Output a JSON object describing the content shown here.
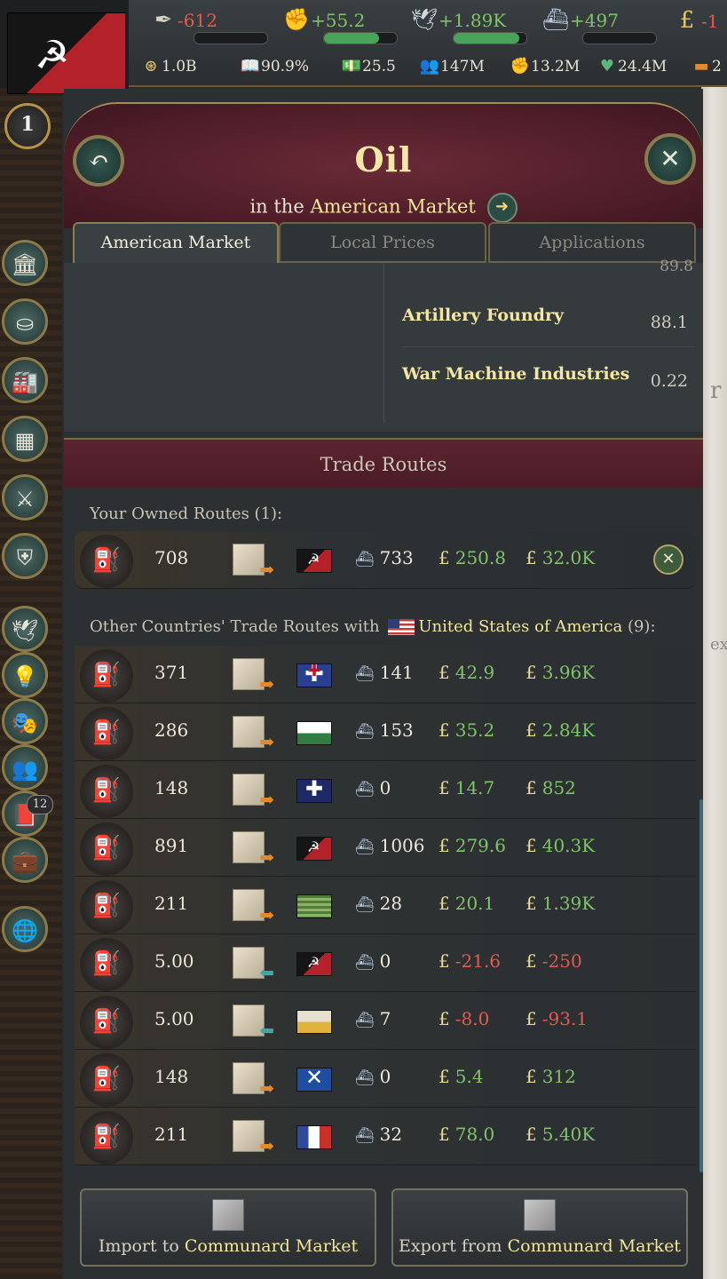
{
  "topbar": {
    "stats": [
      {
        "icon": "quill-icon",
        "value": "-612",
        "tone": "neg",
        "bar": 0.0
      },
      {
        "icon": "fist-icon",
        "value": "+55.2",
        "tone": "pos",
        "bar": 0.75
      },
      {
        "icon": "dove-icon",
        "value": "+1.89K",
        "tone": "pos",
        "bar": 0.9
      },
      {
        "icon": "ship-icon",
        "value": "+497",
        "tone": "pos",
        "bar": 0.0
      },
      {
        "icon": "pound-icon",
        "value": "-1",
        "tone": "neg"
      }
    ],
    "stats2": [
      {
        "icon": "coin-icon",
        "value": "1.0B"
      },
      {
        "icon": "book-icon",
        "value": "90.9%"
      },
      {
        "icon": "money-icon",
        "value": "25.5"
      },
      {
        "icon": "people-icon",
        "value": "147M"
      },
      {
        "icon": "raised-fist-icon",
        "value": "13.2M"
      },
      {
        "icon": "heart-icon",
        "value": "24.4M"
      },
      {
        "icon": "bar-icon",
        "value": "2"
      }
    ],
    "rank": "1"
  },
  "panel": {
    "title": "Oil",
    "subtitle_prefix": "in the",
    "subtitle_market": "American Market",
    "tabs": [
      "American Market",
      "Local Prices",
      "Applications"
    ],
    "buildings_partial_value": "89.8",
    "buildings": [
      {
        "name": "Artillery Foundry",
        "value": "88.1"
      },
      {
        "name": "War Machine Industries",
        "value": "0.22"
      }
    ],
    "trade_routes_title": "Trade Routes",
    "owned_label": "Your Owned Routes (1):",
    "owned_routes": [
      {
        "level": "708",
        "dir": "export",
        "flag": "commune",
        "ships": "733",
        "m1": "250.8",
        "m2": "32.0K",
        "tone": "pos"
      }
    ],
    "other_label_prefix": "Other Countries' Trade Routes with",
    "other_country": "United States of America",
    "other_count": "(9):",
    "other_routes": [
      {
        "level": "371",
        "dir": "export",
        "flag": "uk",
        "ships": "141",
        "m1": "42.9",
        "m2": "3.96K",
        "tone": "pos"
      },
      {
        "level": "286",
        "dir": "export",
        "flag": "green-white",
        "ships": "153",
        "m1": "35.2",
        "m2": "2.84K",
        "tone": "pos"
      },
      {
        "level": "148",
        "dir": "export",
        "flag": "blue-cross",
        "ships": "0",
        "m1": "14.7",
        "m2": "852",
        "tone": "pos"
      },
      {
        "level": "891",
        "dir": "export",
        "flag": "commune",
        "ships": "1006",
        "m1": "279.6",
        "m2": "40.3K",
        "tone": "pos"
      },
      {
        "level": "211",
        "dir": "export",
        "flag": "green-stripes",
        "ships": "28",
        "m1": "20.1",
        "m2": "1.39K",
        "tone": "pos"
      },
      {
        "level": "5.00",
        "dir": "import",
        "flag": "commune",
        "ships": "0",
        "m1": "-21.6",
        "m2": "-250",
        "tone": "neg"
      },
      {
        "level": "5.00",
        "dir": "import",
        "flag": "yellow-white",
        "ships": "7",
        "m1": "-8.0",
        "m2": "-93.1",
        "tone": "neg"
      },
      {
        "level": "148",
        "dir": "export",
        "flag": "scotland",
        "ships": "0",
        "m1": "5.4",
        "m2": "312",
        "tone": "pos"
      },
      {
        "level": "211",
        "dir": "export",
        "flag": "tricolor",
        "ships": "32",
        "m1": "78.0",
        "m2": "5.40K",
        "tone": "pos"
      }
    ],
    "import_btn_prefix": "Import to",
    "import_btn_market": "Communard Market",
    "export_btn_prefix": "Export from",
    "export_btn_market": "Communard Market"
  },
  "sidebar": {
    "badge": "12"
  },
  "colors": {
    "positive": "#7fc46b",
    "negative": "#e05b52",
    "gold": "#f3e59c"
  }
}
